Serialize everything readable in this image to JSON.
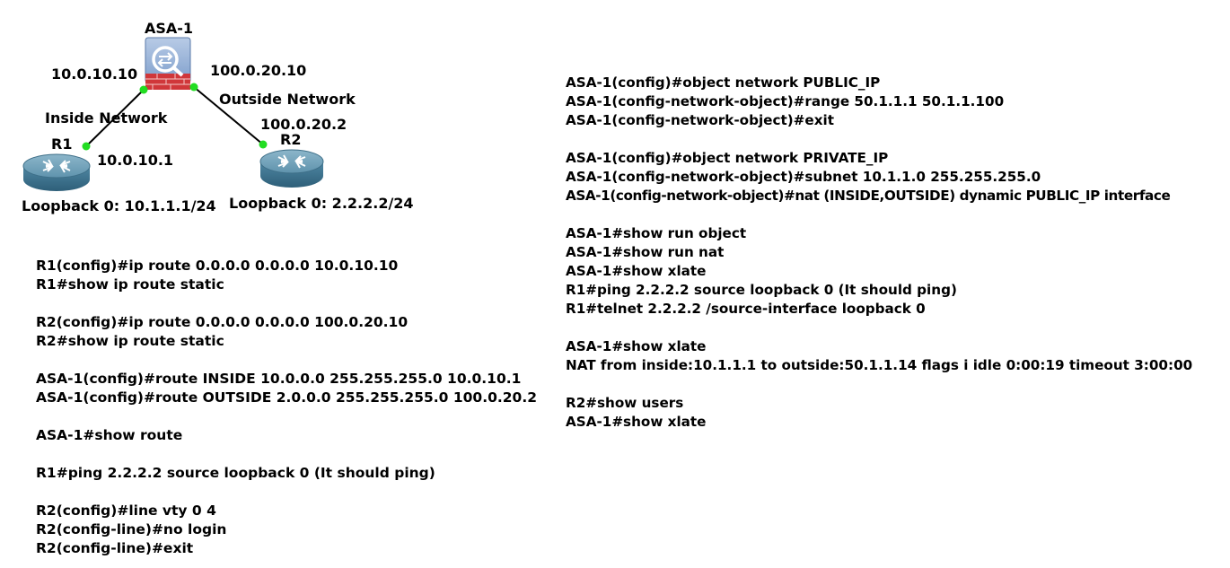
{
  "topology": {
    "asa": {
      "name": "ASA-1",
      "inside_ip": "10.0.10.10",
      "outside_ip": "100.0.20.10"
    },
    "r1": {
      "name": "R1",
      "ip": "10.0.10.1",
      "loopback": "Loopback 0: 10.1.1.1/24"
    },
    "r2": {
      "name": "R2",
      "ip": "100.0.20.2",
      "loopback": "Loopback 0: 2.2.2.2/24"
    },
    "inside_label": "Inside Network",
    "outside_label": "Outside Network",
    "colors": {
      "link_dot": "#22dd22",
      "link": "#000000",
      "router_body": "#4a7f98",
      "firewall_red": "#d0373a"
    }
  },
  "left_commands": [
    [
      "R1(config)#ip route 0.0.0.0 0.0.0.0 10.0.10.10",
      "R1#show ip route static"
    ],
    [
      "R2(config)#ip route 0.0.0.0 0.0.0.0 100.0.20.10",
      "R2#show ip route static"
    ],
    [
      "ASA-1(config)#route INSIDE 10.0.0.0 255.255.255.0 10.0.10.1",
      "ASA-1(config)#route OUTSIDE 2.0.0.0 255.255.255.0 100.0.20.2"
    ],
    [
      "ASA-1#show route"
    ],
    [
      "R1#ping 2.2.2.2 source loopback 0 (It should ping)"
    ],
    [
      "R2(config)#line vty 0 4",
      "R2(config-line)#no login",
      "R2(config-line)#exit"
    ]
  ],
  "right_commands": [
    [
      "ASA-1(config)#object network PUBLIC_IP",
      "ASA-1(config-network-object)#range 50.1.1.1 50.1.1.100",
      "ASA-1(config-network-object)#exit"
    ],
    [
      "ASA-1(config)#object network PRIVATE_IP",
      "ASA-1(config-network-object)#subnet 10.1.1.0 255.255.255.0",
      "ASA-1(config-network-object)#nat (INSIDE,OUTSIDE) dynamic PUBLIC_IP interface"
    ],
    [
      "ASA-1#show run object",
      "ASA-1#show run nat",
      "ASA-1#show xlate",
      "R1#ping 2.2.2.2 source loopback 0 (It should ping)",
      "R1#telnet 2.2.2.2 /source-interface loopback 0"
    ],
    [
      "ASA-1#show xlate",
      "NAT from inside:10.1.1.1 to outside:50.1.1.14 flags i idle 0:00:19 timeout 3:00:00"
    ],
    [
      "R2#show users",
      "ASA-1#show xlate"
    ]
  ]
}
